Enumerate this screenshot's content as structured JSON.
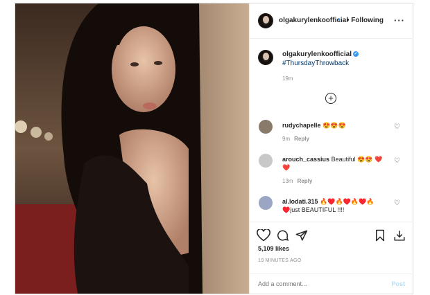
{
  "account": {
    "username": "olgakurylenkoofficial",
    "following_label": "Following"
  },
  "caption": {
    "username": "olgakurylenkoofficial",
    "hashtag": "#ThursdayThrowback",
    "time": "19m"
  },
  "comments": [
    {
      "username": "rudychapelle",
      "text": "😍😍😍",
      "time": "9m",
      "reply": "Reply"
    },
    {
      "username": "arouch_cassius",
      "text": "Beautiful 😍😍 ❤️❤️",
      "time": "13m",
      "reply": "Reply"
    },
    {
      "username": "al.lodati.315",
      "text": "🔥♥️🔥♥️🔥♥️🔥♥️just BEAUTIFUL !!!!",
      "time": "",
      "reply": ""
    }
  ],
  "stats": {
    "likes": "5,109 likes",
    "posted": "19 MINUTES AGO"
  },
  "add_comment": {
    "placeholder": "Add a comment...",
    "post_label": "Post"
  },
  "colors": {
    "link": "#00376b",
    "verified": "#3897f0",
    "post_disabled": "#b2dffc"
  }
}
